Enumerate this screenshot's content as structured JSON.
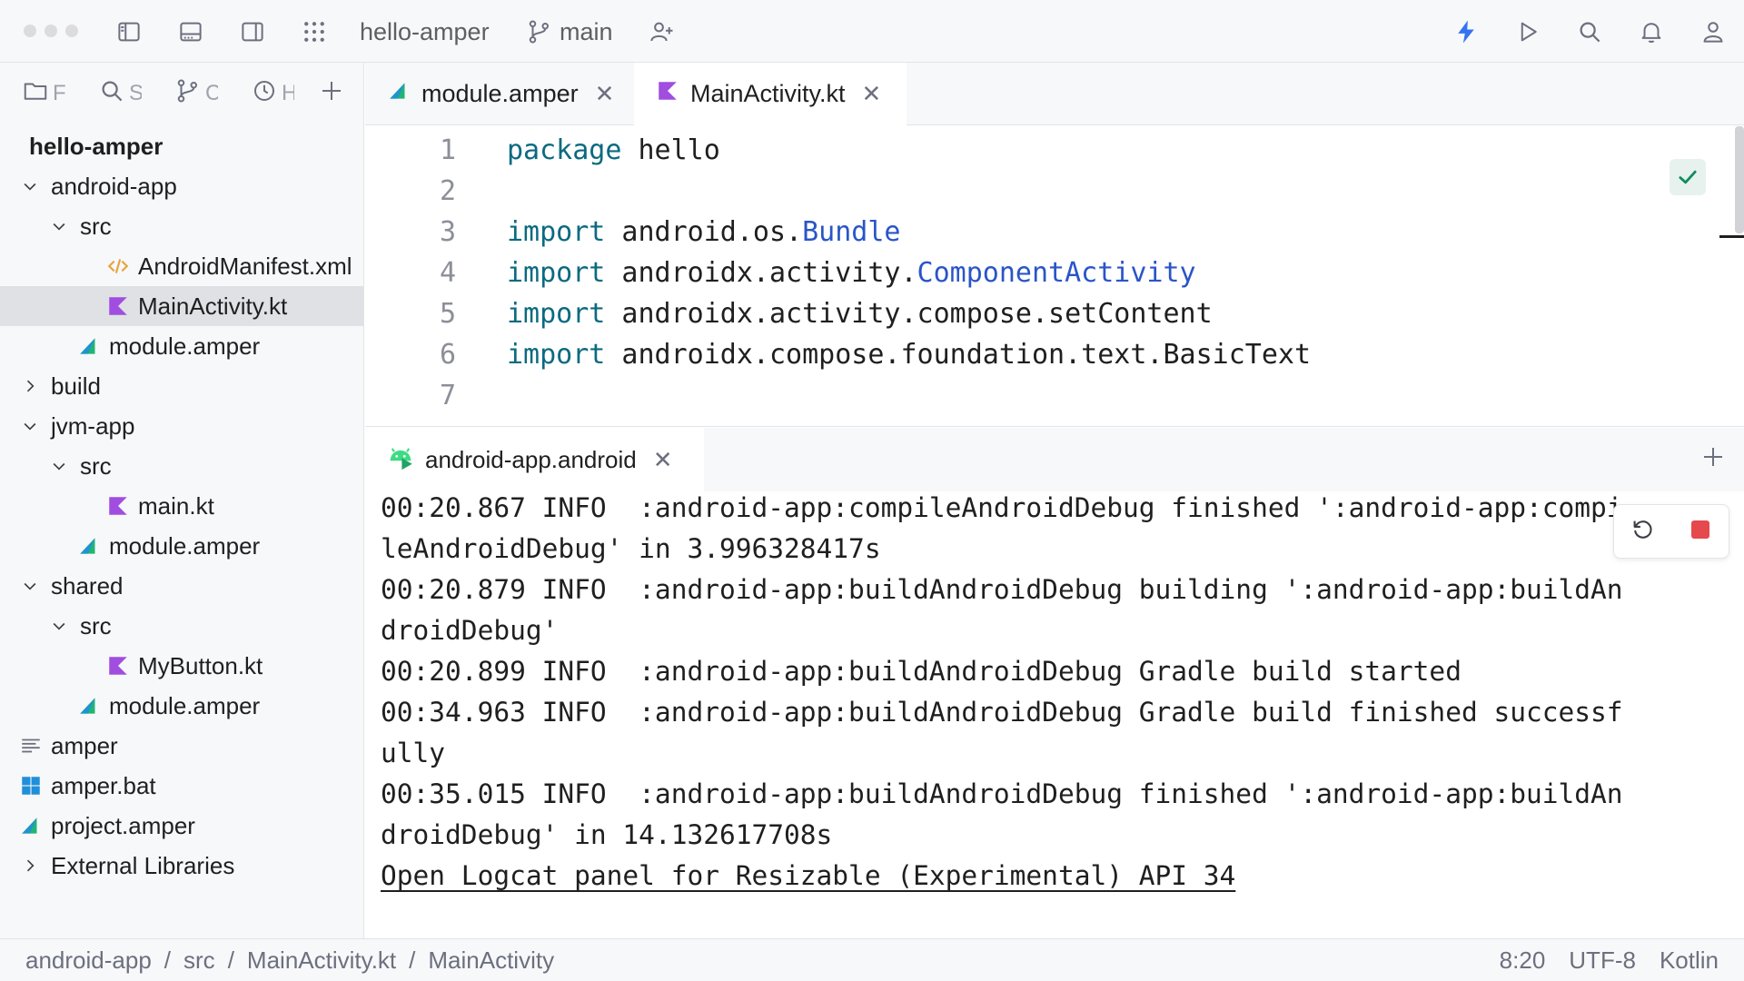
{
  "titlebar": {
    "project": "hello-amper",
    "branch": "main"
  },
  "sidebar": {
    "tabs": [
      {
        "icon": "folder-icon",
        "label": "F"
      },
      {
        "icon": "search-icon",
        "label": "S"
      },
      {
        "icon": "git-branch-icon",
        "label": "C"
      },
      {
        "icon": "clock-icon",
        "label": "H"
      }
    ],
    "tree": [
      {
        "label": "hello-amper",
        "depth": 0,
        "kind": "root"
      },
      {
        "label": "android-app",
        "depth": 0,
        "kind": "dir-open"
      },
      {
        "label": "src",
        "depth": 1,
        "kind": "dir-open"
      },
      {
        "label": "AndroidManifest.xml",
        "depth": 2,
        "kind": "xml"
      },
      {
        "label": "MainActivity.kt",
        "depth": 2,
        "kind": "kotlin",
        "selected": true
      },
      {
        "label": "module.amper",
        "depth": 1,
        "kind": "amper"
      },
      {
        "label": "build",
        "depth": 0,
        "kind": "dir-closed"
      },
      {
        "label": "jvm-app",
        "depth": 0,
        "kind": "dir-open"
      },
      {
        "label": "src",
        "depth": 1,
        "kind": "dir-open"
      },
      {
        "label": "main.kt",
        "depth": 2,
        "kind": "kotlin"
      },
      {
        "label": "module.amper",
        "depth": 1,
        "kind": "amper"
      },
      {
        "label": "shared",
        "depth": 0,
        "kind": "dir-open"
      },
      {
        "label": "src",
        "depth": 1,
        "kind": "dir-open"
      },
      {
        "label": "MyButton.kt",
        "depth": 2,
        "kind": "kotlin"
      },
      {
        "label": "module.amper",
        "depth": 1,
        "kind": "amper"
      },
      {
        "label": "amper",
        "depth": 0,
        "kind": "text"
      },
      {
        "label": "amper.bat",
        "depth": 0,
        "kind": "windows"
      },
      {
        "label": "project.amper",
        "depth": 0,
        "kind": "amper"
      },
      {
        "label": "External Libraries",
        "depth": 0,
        "kind": "dir-closed"
      }
    ]
  },
  "editor_tabs": [
    {
      "label": "module.amper",
      "icon": "amper-icon",
      "active": false
    },
    {
      "label": "MainActivity.kt",
      "icon": "kotlin-icon",
      "active": true
    }
  ],
  "editor": {
    "lines": [
      {
        "n": "1",
        "parts": [
          [
            "kw",
            "package"
          ],
          [
            "",
            " hello"
          ]
        ]
      },
      {
        "n": "2",
        "parts": []
      },
      {
        "n": "3",
        "parts": [
          [
            "kw",
            "import"
          ],
          [
            "",
            " android.os."
          ],
          [
            "ty",
            "Bundle"
          ]
        ]
      },
      {
        "n": "4",
        "parts": [
          [
            "kw",
            "import"
          ],
          [
            "",
            " androidx.activity."
          ],
          [
            "ty",
            "ComponentActivity"
          ]
        ]
      },
      {
        "n": "5",
        "parts": [
          [
            "kw",
            "import"
          ],
          [
            "",
            " androidx.activity.compose.setContent"
          ]
        ]
      },
      {
        "n": "6",
        "parts": [
          [
            "kw",
            "import"
          ],
          [
            "",
            " androidx.compose.foundation.text.BasicText"
          ]
        ]
      },
      {
        "n": "7",
        "parts": []
      }
    ]
  },
  "run": {
    "tab_label": "android-app.android",
    "lines": [
      "00:20.867 INFO  :android-app:compileAndroidDebug finished ':android-app:compi",
      "leAndroidDebug' in 3.996328417s",
      "00:20.879 INFO  :android-app:buildAndroidDebug building ':android-app:buildAn",
      "droidDebug'",
      "00:20.899 INFO  :android-app:buildAndroidDebug Gradle build started",
      "00:34.963 INFO  :android-app:buildAndroidDebug Gradle build finished successf",
      "ully",
      "00:35.015 INFO  :android-app:buildAndroidDebug finished ':android-app:buildAn",
      "droidDebug' in 14.132617708s"
    ],
    "link": "Open Logcat panel for Resizable (Experimental) API 34"
  },
  "statusbar": {
    "breadcrumbs": [
      "android-app",
      "src",
      "MainActivity.kt",
      "MainActivity"
    ],
    "separator": "/",
    "position": "8:20",
    "encoding": "UTF-8",
    "language": "Kotlin"
  },
  "colors": {
    "accent": "#3574f0",
    "kotlin": "#a04de0",
    "amper_green": "#21b573",
    "stop": "#e5484d"
  }
}
